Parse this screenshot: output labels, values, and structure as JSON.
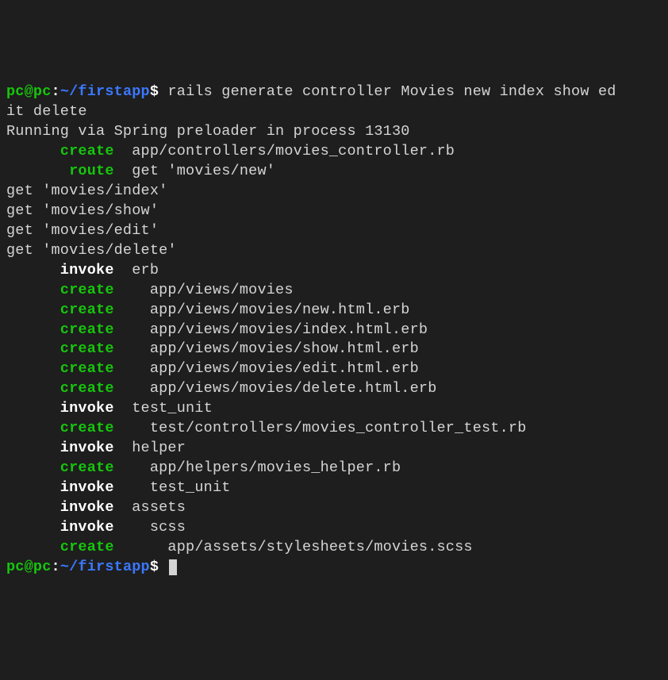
{
  "prompt1": {
    "userhost": "pc@pc",
    "colon": ":",
    "path": "~/firstapp",
    "dollar": "$ ",
    "command": "rails generate controller Movies new index show ed\nit delete"
  },
  "lines": {
    "running": "Running via Spring preloader in process 13130",
    "l1_action": "      create",
    "l1_path": "  app/controllers/movies_controller.rb",
    "l2_action": "       route",
    "l2_path": "  get 'movies/new'",
    "l3": "get 'movies/index'",
    "l4": "get 'movies/show'",
    "l5": "get 'movies/edit'",
    "l6": "get 'movies/delete'",
    "l7_action": "      invoke",
    "l7_path": "  erb",
    "l8_action": "      create",
    "l8_path": "    app/views/movies",
    "l9_action": "      create",
    "l9_path": "    app/views/movies/new.html.erb",
    "l10_action": "      create",
    "l10_path": "    app/views/movies/index.html.erb",
    "l11_action": "      create",
    "l11_path": "    app/views/movies/show.html.erb",
    "l12_action": "      create",
    "l12_path": "    app/views/movies/edit.html.erb",
    "l13_action": "      create",
    "l13_path": "    app/views/movies/delete.html.erb",
    "l14_action": "      invoke",
    "l14_path": "  test_unit",
    "l15_action": "      create",
    "l15_path": "    test/controllers/movies_controller_test.rb",
    "l16_action": "      invoke",
    "l16_path": "  helper",
    "l17_action": "      create",
    "l17_path": "    app/helpers/movies_helper.rb",
    "l18_action": "      invoke",
    "l18_path": "    test_unit",
    "l19_action": "      invoke",
    "l19_path": "  assets",
    "l20_action": "      invoke",
    "l20_path": "    scss",
    "l21_action": "      create",
    "l21_path": "      app/assets/stylesheets/movies.scss"
  },
  "prompt2": {
    "userhost": "pc@pc",
    "colon": ":",
    "path": "~/firstapp",
    "dollar": "$ "
  }
}
